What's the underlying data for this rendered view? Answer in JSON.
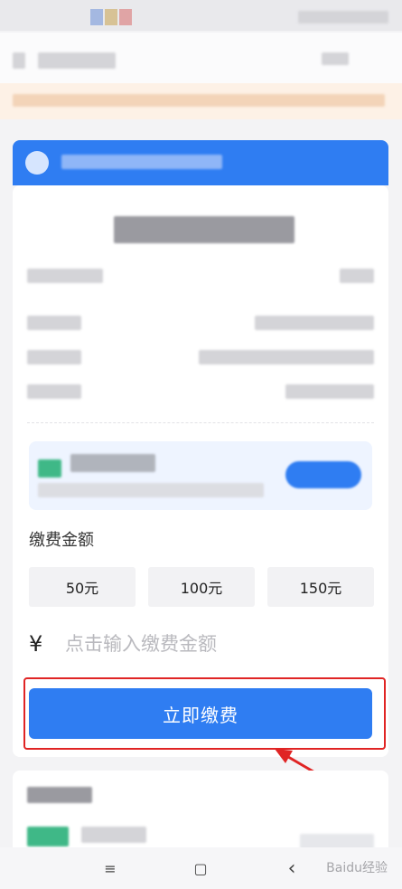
{
  "payment": {
    "amount_label": "缴费金额",
    "presets": [
      {
        "label": "50元"
      },
      {
        "label": "100元"
      },
      {
        "label": "150元"
      }
    ],
    "currency_symbol": "¥",
    "amount_placeholder": "点击输入缴费金额",
    "pay_button_label": "立即缴费"
  },
  "system_nav": {
    "menu_glyph": "≡",
    "home_glyph": "▢",
    "back_glyph": "‹"
  },
  "watermark": "Baidu经验",
  "colors": {
    "primary": "#2f7df2",
    "highlight_border": "#e02424",
    "page_background": "#f3f3f5"
  }
}
